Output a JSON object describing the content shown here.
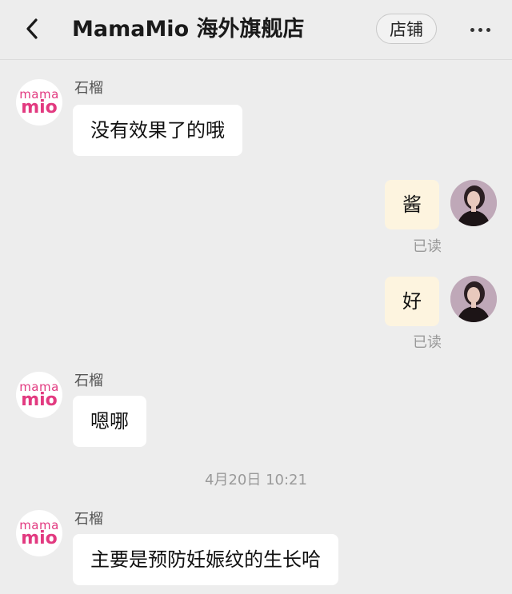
{
  "header": {
    "back_icon": "chevron-left-icon",
    "title": "MamaMio 海外旗舰店",
    "store_label": "店铺",
    "more_icon": "more-horizontal-icon"
  },
  "store_logo": {
    "top": "mama",
    "bottom": "mio"
  },
  "messages": [
    {
      "side": "in",
      "sender": "石榴",
      "text": "没有效果了的哦"
    },
    {
      "side": "out",
      "text": "酱",
      "status": "已读"
    },
    {
      "side": "out",
      "text": "好",
      "status": "已读"
    },
    {
      "side": "in",
      "sender": "石榴",
      "text": "嗯哪"
    },
    {
      "side": "in",
      "sender": "石榴",
      "text": "主要是预防妊娠纹的生长哈"
    }
  ],
  "timestamp": "4月20日 10:21",
  "colors": {
    "background": "#ededed",
    "brand_pink": "#e23a80",
    "outgoing_bubble": "#fdf4df",
    "incoming_bubble": "#ffffff"
  }
}
